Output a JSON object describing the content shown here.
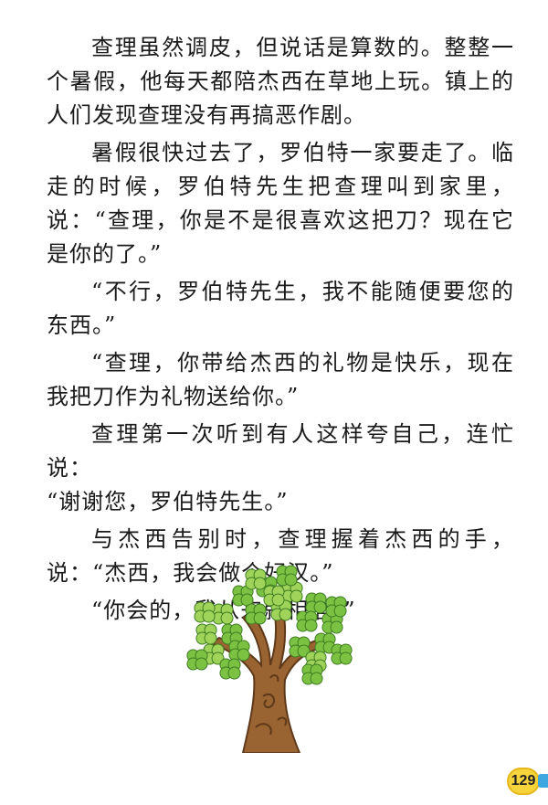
{
  "paragraphs": [
    "查理虽然调皮，但说话是算数的。整整一个暑假，他每天都陪杰西在草地上玩。镇上的人们发现查理没有再搞恶作剧。",
    "暑假很快过去了，罗伯特一家要走了。临走的时候，罗伯特先生把查理叫到家里，说：“查理，你是不是很喜欢这把刀？现在它是你的了。”",
    "“不行，罗伯特先生，我不能随便要您的东西。”",
    "“查理，你带给杰西的礼物是快乐，现在我把刀作为礼物送给你。”",
    "查理第一次听到有人这样夸自己，连忙说：",
    "“谢谢您，罗伯特先生。”",
    "与杰西告别时，查理握着杰西的手，说：“杰西，我会做个好汉。”",
    "“你会的，我从来就相信。”"
  ],
  "illustration": {
    "name": "tree-illustration",
    "leaf_color": "#7cc242",
    "trunk_color": "#8b5a2b"
  },
  "page_number": "129",
  "colors": {
    "page_badge": "#f6d43b",
    "page_tab": "#3fa7df"
  }
}
